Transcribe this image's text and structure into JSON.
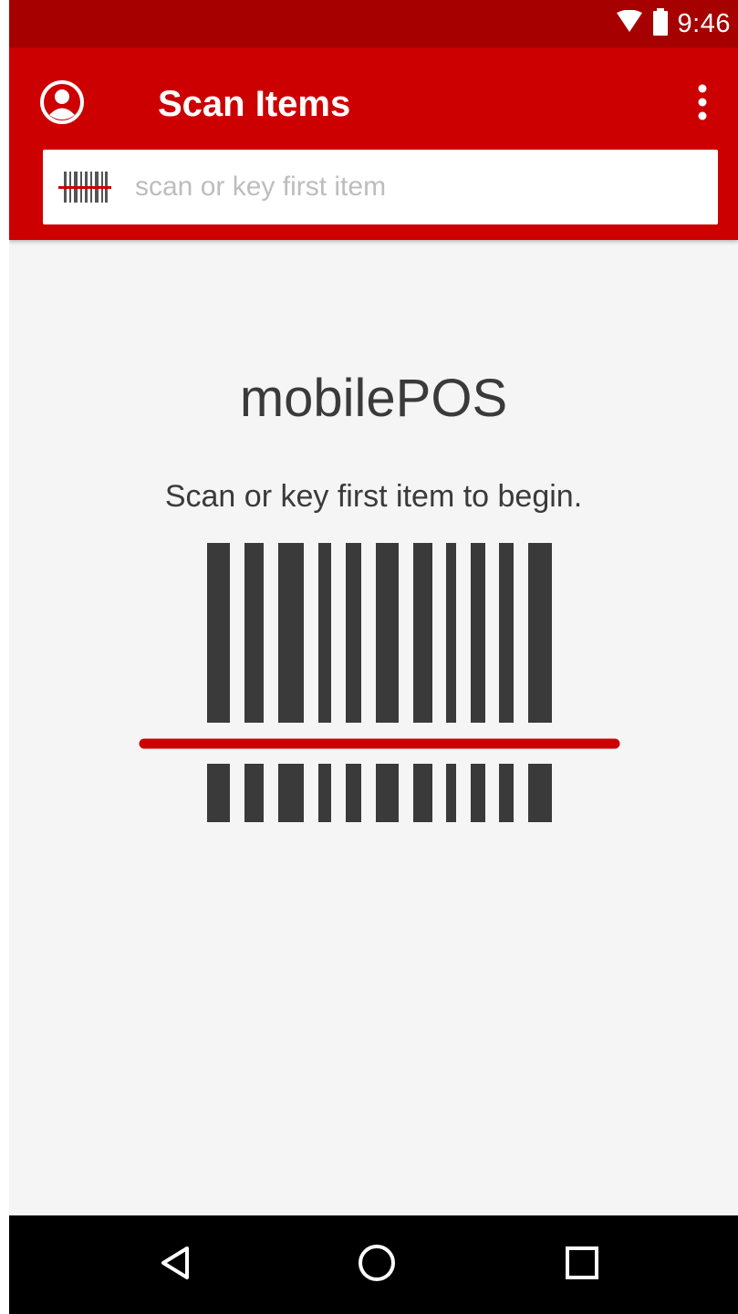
{
  "status_bar": {
    "time": "9:46",
    "icons": [
      "wifi-icon",
      "battery-icon"
    ],
    "background": "#a60000"
  },
  "app_bar": {
    "title": "Scan Items",
    "background": "#cc0000",
    "account_icon": "account-circle-icon",
    "overflow_icon": "more-vert-icon"
  },
  "search": {
    "placeholder": "scan or key first item",
    "value": "",
    "icon": "barcode-scan-icon"
  },
  "main": {
    "brand": "mobilePOS",
    "instruction": "Scan or key first item to begin.",
    "illustration": "barcode-scanner-illustration",
    "scan_line_color": "#cc0000"
  },
  "nav_bar": {
    "buttons": [
      "back-icon",
      "home-icon",
      "recents-icon"
    ]
  }
}
